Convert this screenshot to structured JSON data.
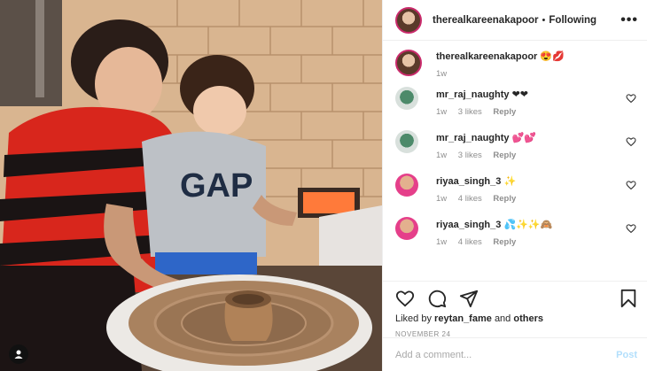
{
  "post": {
    "header": {
      "username": "therealkareenakapoor",
      "separator": "•",
      "follow_status": "Following",
      "more_icon": "more-icon"
    },
    "caption": {
      "username": "therealkareenakapoor",
      "text": "😍💋",
      "time": "1w"
    },
    "comments": [
      {
        "username": "mr_raj_naughty",
        "text": "❤❤",
        "time": "1w",
        "likes": "3 likes",
        "reply": "Reply"
      },
      {
        "username": "mr_raj_naughty",
        "text": "💕💕",
        "time": "1w",
        "likes": "3 likes",
        "reply": "Reply"
      },
      {
        "username": "riyaa_singh_3",
        "text": "✨",
        "time": "1w",
        "likes": "4 likes",
        "reply": "Reply"
      },
      {
        "username": "riyaa_singh_3",
        "text": "💦✨✨🙈",
        "time": "1w",
        "likes": "4 likes",
        "reply": "Reply"
      }
    ],
    "liked_by": {
      "prefix": "Liked by",
      "user": "reytan_fame",
      "conjunction": "and",
      "others": "others"
    },
    "date": "NOVEMBER 24",
    "add_comment": {
      "placeholder": "Add a comment...",
      "post_label": "Post"
    }
  }
}
